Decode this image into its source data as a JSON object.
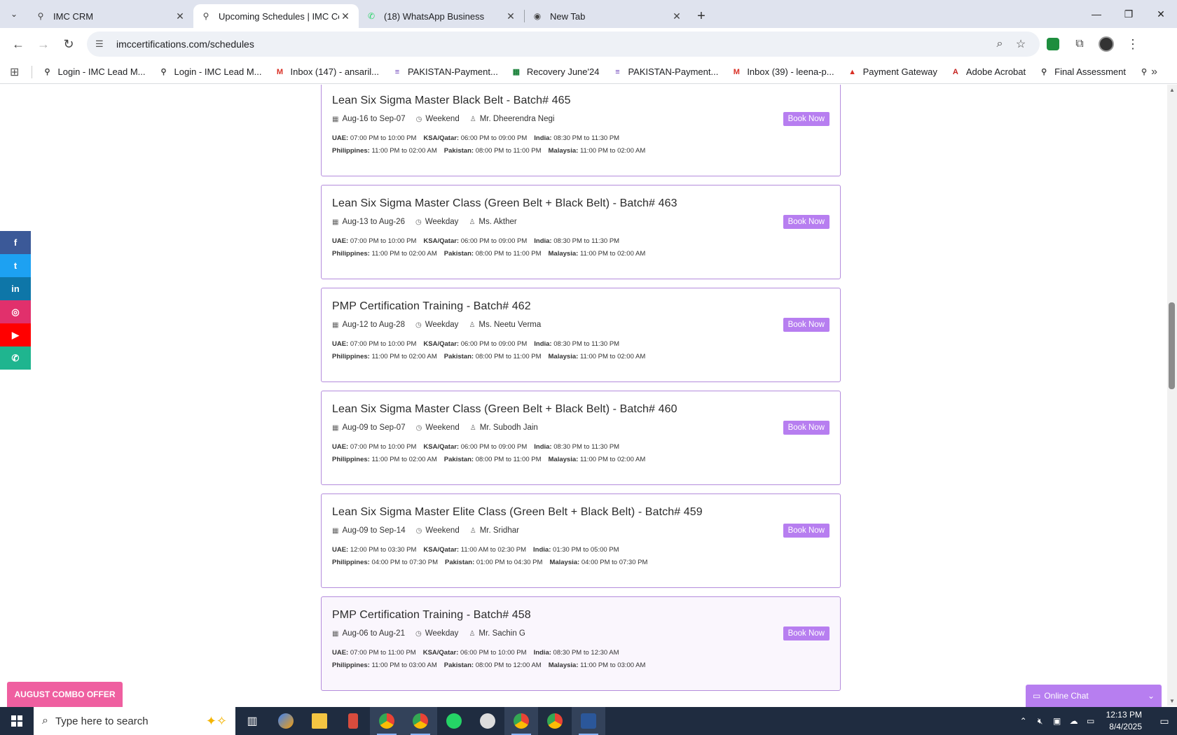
{
  "browser": {
    "tabs": [
      {
        "label": "IMC CRM",
        "active": false,
        "icon": "imc-icon"
      },
      {
        "label": "Upcoming Schedules | IMC Certi",
        "active": true,
        "icon": "imc-icon"
      },
      {
        "label": "(18) WhatsApp Business",
        "active": false,
        "icon": "whatsapp-icon"
      },
      {
        "label": "New Tab",
        "active": false,
        "icon": "chrome-icon"
      }
    ],
    "url": "imccertifications.com/schedules",
    "bookmarks": [
      {
        "label": "Login - IMC Lead M...",
        "icon": "imc-icon"
      },
      {
        "label": "Login - IMC Lead M...",
        "icon": "imc-icon"
      },
      {
        "label": "Inbox (147) - ansaril...",
        "icon": "gmail-icon"
      },
      {
        "label": "PAKISTAN-Payment...",
        "icon": "forms-icon"
      },
      {
        "label": "Recovery June'24",
        "icon": "sheets-icon"
      },
      {
        "label": "PAKISTAN-Payment...",
        "icon": "forms-icon"
      },
      {
        "label": "Inbox (39) - leena-p...",
        "icon": "gmail-icon"
      },
      {
        "label": "Payment Gateway",
        "icon": "gateway-icon"
      },
      {
        "label": "Adobe Acrobat",
        "icon": "acrobat-icon"
      },
      {
        "label": "Final Assessment",
        "icon": "imc-icon"
      }
    ]
  },
  "schedules": [
    {
      "title": "Lean Six Sigma Master Black Belt - Batch# 465",
      "dates": "Aug-16 to Sep-07",
      "mode": "Weekend",
      "trainer": "Mr. Dheerendra Negi",
      "row1": [
        {
          "k": "UAE:",
          "v": "07:00 PM to 10:00 PM"
        },
        {
          "k": "KSA/Qatar:",
          "v": "06:00 PM to 09:00 PM"
        },
        {
          "k": "India:",
          "v": "08:30 PM to 11:30 PM"
        }
      ],
      "row2": [
        {
          "k": "Philippines:",
          "v": "11:00 PM to 02:00 AM"
        },
        {
          "k": "Pakistan:",
          "v": "08:00 PM to 11:00 PM"
        },
        {
          "k": "Malaysia:",
          "v": "11:00 PM to 02:00 AM"
        }
      ],
      "book": "Book Now"
    },
    {
      "title": "Lean Six Sigma Master Class (Green Belt + Black Belt) - Batch# 463",
      "dates": "Aug-13 to Aug-26",
      "mode": "Weekday",
      "trainer": "Ms. Akther",
      "row1": [
        {
          "k": "UAE:",
          "v": "07:00 PM to 10:00 PM"
        },
        {
          "k": "KSA/Qatar:",
          "v": "06:00 PM to 09:00 PM"
        },
        {
          "k": "India:",
          "v": "08:30 PM to 11:30 PM"
        }
      ],
      "row2": [
        {
          "k": "Philippines:",
          "v": "11:00 PM to 02:00 AM"
        },
        {
          "k": "Pakistan:",
          "v": "08:00 PM to 11:00 PM"
        },
        {
          "k": "Malaysia:",
          "v": "11:00 PM to 02:00 AM"
        }
      ],
      "book": "Book Now"
    },
    {
      "title": "PMP Certification Training - Batch# 462",
      "dates": "Aug-12 to Aug-28",
      "mode": "Weekday",
      "trainer": "Ms. Neetu Verma",
      "row1": [
        {
          "k": "UAE:",
          "v": "07:00 PM to 10:00 PM"
        },
        {
          "k": "KSA/Qatar:",
          "v": "06:00 PM to 09:00 PM"
        },
        {
          "k": "India:",
          "v": "08:30 PM to 11:30 PM"
        }
      ],
      "row2": [
        {
          "k": "Philippines:",
          "v": "11:00 PM to 02:00 AM"
        },
        {
          "k": "Pakistan:",
          "v": "08:00 PM to 11:00 PM"
        },
        {
          "k": "Malaysia:",
          "v": "11:00 PM to 02:00 AM"
        }
      ],
      "book": "Book Now"
    },
    {
      "title": "Lean Six Sigma Master Class (Green Belt + Black Belt) - Batch# 460",
      "dates": "Aug-09 to Sep-07",
      "mode": "Weekend",
      "trainer": "Mr. Subodh Jain",
      "row1": [
        {
          "k": "UAE:",
          "v": "07:00 PM to 10:00 PM"
        },
        {
          "k": "KSA/Qatar:",
          "v": "06:00 PM to 09:00 PM"
        },
        {
          "k": "India:",
          "v": "08:30 PM to 11:30 PM"
        }
      ],
      "row2": [
        {
          "k": "Philippines:",
          "v": "11:00 PM to 02:00 AM"
        },
        {
          "k": "Pakistan:",
          "v": "08:00 PM to 11:00 PM"
        },
        {
          "k": "Malaysia:",
          "v": "11:00 PM to 02:00 AM"
        }
      ],
      "book": "Book Now"
    },
    {
      "title": "Lean Six Sigma Master Elite Class (Green Belt + Black Belt) - Batch# 459",
      "dates": "Aug-09 to Sep-14",
      "mode": "Weekend",
      "trainer": "Mr. Sridhar",
      "row1": [
        {
          "k": "UAE:",
          "v": "12:00 PM to 03:30 PM"
        },
        {
          "k": "KSA/Qatar:",
          "v": "11:00 AM to 02:30 PM"
        },
        {
          "k": "India:",
          "v": "01:30 PM to 05:00 PM"
        }
      ],
      "row2": [
        {
          "k": "Philippines:",
          "v": "04:00 PM to 07:30 PM"
        },
        {
          "k": "Pakistan:",
          "v": "01:00 PM to 04:30 PM"
        },
        {
          "k": "Malaysia:",
          "v": "04:00 PM to 07:30 PM"
        }
      ],
      "book": "Book Now"
    },
    {
      "title": "PMP Certification Training - Batch# 458",
      "dates": "Aug-06 to Aug-21",
      "mode": "Weekday",
      "trainer": "Mr. Sachin G",
      "row1": [
        {
          "k": "UAE:",
          "v": "07:00 PM to 11:00 PM"
        },
        {
          "k": "KSA/Qatar:",
          "v": "06:00 PM to 10:00 PM"
        },
        {
          "k": "India:",
          "v": "08:30 PM to 12:30 AM"
        }
      ],
      "row2": [
        {
          "k": "Philippines:",
          "v": "11:00 PM to 03:00 AM"
        },
        {
          "k": "Pakistan:",
          "v": "08:00 PM to 12:00 AM"
        },
        {
          "k": "Malaysia:",
          "v": "11:00 PM to 03:00 AM"
        }
      ],
      "book": "Book Now"
    }
  ],
  "social": [
    {
      "name": "facebook-icon",
      "glyph": "f",
      "color": "#3b5998"
    },
    {
      "name": "twitter-icon",
      "glyph": "t",
      "color": "#1da1f2"
    },
    {
      "name": "linkedin-icon",
      "glyph": "in",
      "color": "#0e76a8"
    },
    {
      "name": "instagram-icon",
      "glyph": "◎",
      "color": "#e1306c"
    },
    {
      "name": "youtube-icon",
      "glyph": "▶",
      "color": "#ff0000"
    },
    {
      "name": "whatsapp-icon",
      "glyph": "✆",
      "color": "#1fb58f"
    }
  ],
  "offer": "AUGUST COMBO OFFER",
  "chat": "Online Chat",
  "taskbar": {
    "search_placeholder": "Type here to search",
    "time": "12:13 PM",
    "date": "8/4/2025"
  }
}
